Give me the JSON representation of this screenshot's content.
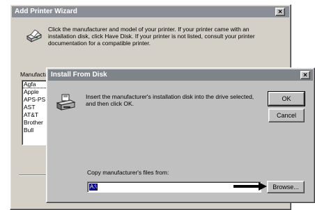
{
  "back_window": {
    "title": "Add Printer Wizard",
    "close_glyph": "×",
    "message": "Click the manufacturer and model of your printer.  If your printer came with an installation disk, click Have Disk.  If your printer is not listed, consult your printer documentation for a compatible printer.",
    "manufacturers_label": "Manufacturers:",
    "manufacturers": [
      "Agfa",
      "Apple",
      "APS-PS",
      "AST",
      "AT&T",
      "Brother",
      "Bull"
    ],
    "selected_manufacturer": "Agfa",
    "icon": "printer-icon"
  },
  "dialog": {
    "title": "Install From Disk",
    "close_glyph": "×",
    "message": "Insert the manufacturer's installation disk into the drive selected, and then click OK.",
    "ok_label": "OK",
    "cancel_label": "Cancel",
    "copy_label": "Copy manufacturer's files from:",
    "copy_value": "A:\\",
    "browse_label": "Browse...",
    "icon": "floppy-drive-icon"
  },
  "colors": {
    "title_bar": "#7f848b",
    "face": "#c0c0c0",
    "selection": "#000080"
  }
}
